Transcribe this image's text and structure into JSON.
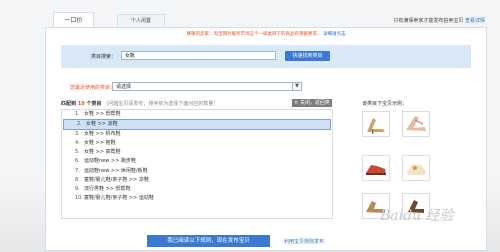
{
  "tabs": [
    {
      "label": "一口价"
    },
    {
      "label": "个人闲置"
    }
  ],
  "top_note": {
    "text": "只有满保卖家才能发布拍卖宝贝",
    "link": "查看详情"
  },
  "notice": {
    "text": "尊敬的卖家：淘宝网对服务市场这个一级类目下的商品有限额要求，",
    "link": "详细请点击"
  },
  "search": {
    "label": "类目搜索：",
    "value": "女靴",
    "button": "快速找到类目"
  },
  "recent": {
    "label": "您最近使用的类目：",
    "value": "请选择"
  },
  "results": {
    "prefix": "匹配到",
    "count": "10",
    "suffix": "个类目",
    "hint": "（问题宝贝请发布，排序依为选择下面对应的数量）",
    "clear_label": "关闭，返回类目"
  },
  "categories": [
    {
      "num": "1.",
      "text": "女鞋 >> 低帮鞋"
    },
    {
      "num": "2.",
      "text": "女鞋 >> 凉鞋"
    },
    {
      "num": "3.",
      "text": "女鞋 >> 帆布鞋"
    },
    {
      "num": "4.",
      "text": "女鞋 >> 拖鞋"
    },
    {
      "num": "5.",
      "text": "女鞋 >> 高帮鞋"
    },
    {
      "num": "6.",
      "text": "运动鞋new >> 跑步鞋"
    },
    {
      "num": "7.",
      "text": "运动鞋new >> 休闲鞋/板鞋"
    },
    {
      "num": "8.",
      "text": "童鞋/婴儿鞋/亲子鞋 >> 凉鞋"
    },
    {
      "num": "9.",
      "text": "流行男鞋 >> 低帮鞋"
    },
    {
      "num": "10.",
      "text": "童鞋/婴儿鞋/亲子鞋 >> 运动鞋"
    }
  ],
  "sidebar": {
    "title": "该类目下宝贝示例："
  },
  "footer": {
    "agree_button": "我已阅读以下规则，现在发布宝贝",
    "rules_link": "利用宝贝规则发布"
  },
  "watermark": "Baidu 经验",
  "colors": {
    "accent": "#3b7ad0",
    "warning": "#e8522a",
    "link": "#2a6fc0"
  }
}
